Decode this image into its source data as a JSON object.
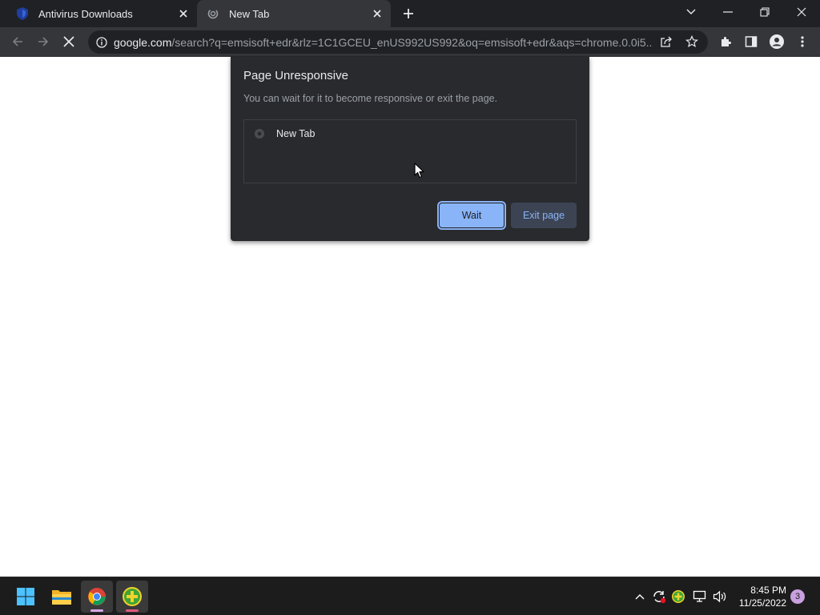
{
  "browser": {
    "tabs": [
      {
        "label": "Antivirus Downloads",
        "icon": "emsisoft-favicon-icon",
        "active": false
      },
      {
        "label": "New Tab",
        "icon": "chrome-loading-icon",
        "active": true
      }
    ],
    "url": {
      "host": "google.com",
      "path": "/search?q=emsisoft+edr&rlz=1C1GCEU_enUS992US992&oq=emsisoft+edr&aqs=chrome.0.0i5..."
    }
  },
  "dialog": {
    "title": "Page Unresponsive",
    "message": "You can wait for it to become responsive or exit the page.",
    "pages": [
      {
        "label": "New Tab"
      }
    ],
    "wait_label": "Wait",
    "exit_label": "Exit page"
  },
  "taskbar": {
    "apps": [
      "windows-start-icon",
      "file-explorer-icon",
      "chrome-icon",
      "emsisoft-icon"
    ],
    "clock": {
      "time": "8:45 PM",
      "date": "11/25/2022"
    },
    "notification_count": "3"
  },
  "colors": {
    "dialog_bg": "#292a2d",
    "accent": "#8ab4f8",
    "toolbar_bg": "#35363a",
    "tabstrip_bg": "#202124"
  }
}
